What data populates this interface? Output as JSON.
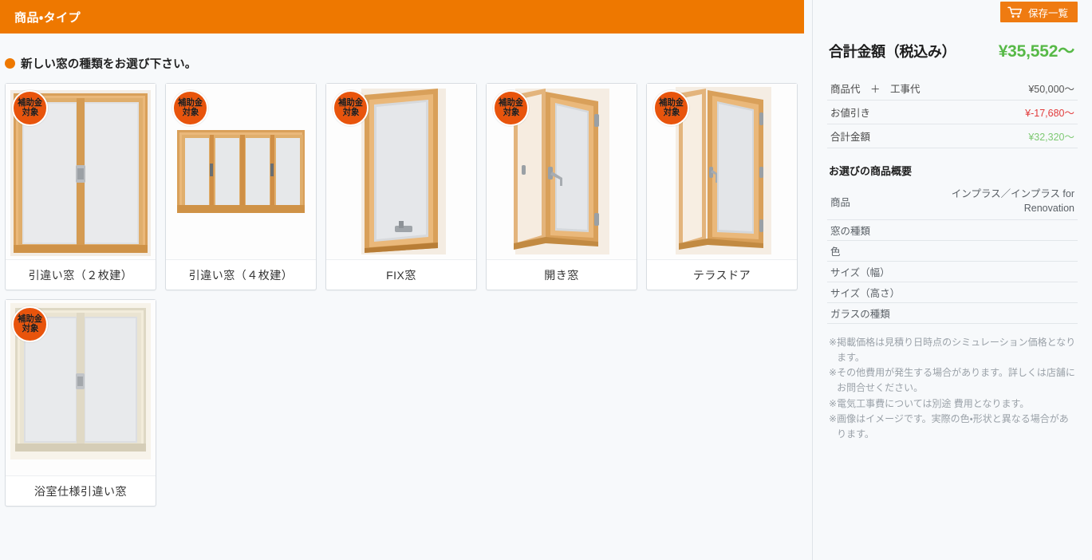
{
  "header": {
    "title": "商品・タイプ",
    "accent_color": "#ee7800"
  },
  "prompt": {
    "text": "新しい窓の種類をお選び下さい。"
  },
  "badge": {
    "line1": "補助金",
    "line2": "対象"
  },
  "cards": [
    {
      "label": "引違い窓（２枚建）",
      "icon": "sliding-window-2-panel",
      "badge": true
    },
    {
      "label": "引違い窓（４枚建）",
      "icon": "sliding-window-4-panel",
      "badge": true
    },
    {
      "label": "FIX窓",
      "icon": "fixed-window",
      "badge": true
    },
    {
      "label": "開き窓",
      "icon": "casement-window",
      "badge": true
    },
    {
      "label": "テラスドア",
      "icon": "terrace-door",
      "badge": true
    },
    {
      "label": "浴室仕様引違い窓",
      "icon": "bathroom-sliding-window",
      "badge": true
    }
  ],
  "sidebar": {
    "save_button": {
      "label": "保存一覧",
      "icon": "cart-icon"
    },
    "total": {
      "label": "合計金額（税込み）",
      "value": "¥35,552〜",
      "color": "#57b947"
    },
    "price_rows": [
      {
        "label": "商品代　＋　工事代",
        "value": "¥50,000〜",
        "style": "neutral"
      },
      {
        "label": "お値引き",
        "value": "¥-17,680〜",
        "style": "minus"
      },
      {
        "label": "合計金額",
        "value": "¥32,320〜",
        "style": "green"
      }
    ],
    "summary_title": "お選びの商品概要",
    "summary_rows": [
      {
        "label": "商品",
        "value": "インプラス／インプラス for Renovation"
      },
      {
        "label": "窓の種類",
        "value": ""
      },
      {
        "label": "色",
        "value": ""
      },
      {
        "label": "サイズ（幅）",
        "value": ""
      },
      {
        "label": "サイズ（高さ）",
        "value": ""
      },
      {
        "label": "ガラスの種類",
        "value": ""
      }
    ],
    "notes": [
      {
        "mark": "※",
        "body": "掲載価格は見積り日時点のシミュレーション価格となります。"
      },
      {
        "mark": "※",
        "body": "その他費用が発生する場合があります。詳しくは店舗にお問合せください。"
      },
      {
        "mark": "※",
        "body": "電気工事費については別途 費用となります。"
      },
      {
        "mark": "※",
        "body": "画像はイメージです。実際の色・形状と異なる場合があります。"
      }
    ]
  }
}
